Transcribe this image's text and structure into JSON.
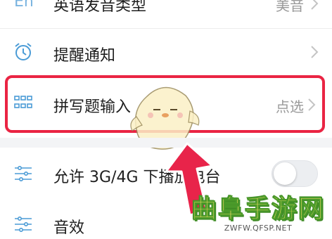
{
  "settings": {
    "rows": [
      {
        "icon": "en-icon",
        "icon_text": "En",
        "label": "英语发音类型",
        "value": "美音"
      },
      {
        "icon": "alarm-clock-icon",
        "label": "提醒通知",
        "value": ""
      },
      {
        "icon": "grid-dots-icon",
        "label": "拼写题输入",
        "value": "点选"
      },
      {
        "icon": "sliders-icon",
        "label": "允许 3G/4G 下播放电台",
        "value": ""
      },
      {
        "icon": "sliders-icon",
        "label": "音效",
        "value": ""
      }
    ],
    "autoplay_toggle_on": false
  },
  "watermark": {
    "brand": "曲阜手游网",
    "url": "ZWFW.QFSP.NET"
  },
  "colors": {
    "highlight": "#ea2443",
    "arrow": "#e8244a",
    "icon_blue": "#4a9bd6"
  }
}
